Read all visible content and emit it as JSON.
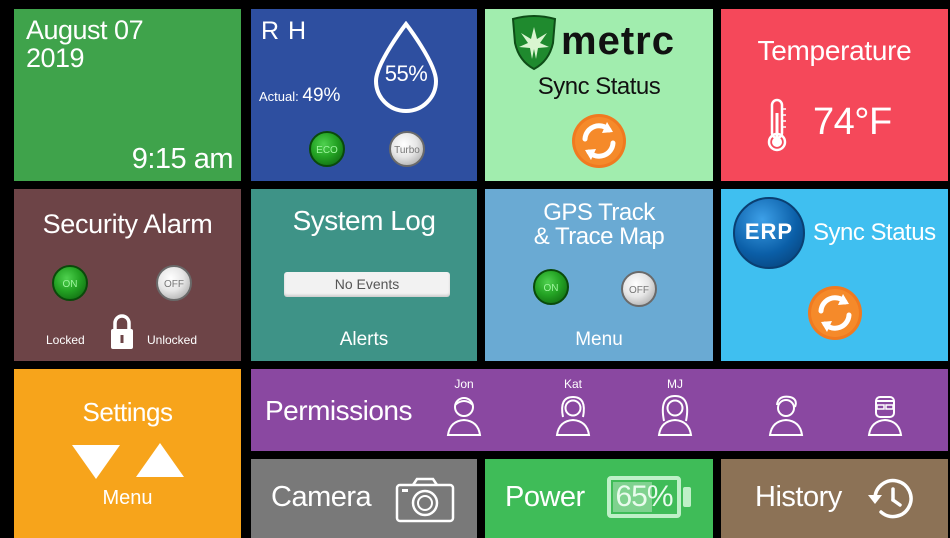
{
  "date_tile": {
    "line1": "August 07",
    "line2": "2019",
    "time": "9:15 am"
  },
  "rh_tile": {
    "title": "R H",
    "actual_label": "Actual:",
    "actual_value": "49%",
    "target_value": "55%",
    "eco_label": "ECO",
    "turbo_label": "Turbo"
  },
  "metrc_tile": {
    "brand": "metrc",
    "subtitle": "Sync Status"
  },
  "temperature_tile": {
    "title": "Temperature",
    "value": "74°F"
  },
  "security_tile": {
    "title": "Security Alarm",
    "on_label": "ON",
    "off_label": "OFF",
    "locked_label": "Locked",
    "unlocked_label": "Unlocked"
  },
  "log_tile": {
    "title": "System Log",
    "status": "No Events",
    "footer": "Alerts"
  },
  "gps_tile": {
    "title_line1": "GPS Track",
    "title_line2": "& Trace Map",
    "on_label": "ON",
    "off_label": "OFF",
    "footer": "Menu"
  },
  "erp_tile": {
    "logo": "ERP",
    "subtitle": "Sync Status"
  },
  "settings_tile": {
    "title": "Settings",
    "footer": "Menu"
  },
  "permissions_tile": {
    "title": "Permissions",
    "users": [
      {
        "name": "Jon"
      },
      {
        "name": "Kat"
      },
      {
        "name": "MJ"
      },
      {
        "name": ""
      },
      {
        "name": ""
      }
    ]
  },
  "camera_tile": {
    "title": "Camera"
  },
  "power_tile": {
    "title": "Power",
    "battery_level": "65%",
    "battery_fraction": 0.65
  },
  "history_tile": {
    "title": "History"
  },
  "colors": {
    "green": "#3fa34b",
    "blue": "#2e4fa0",
    "mint": "#a1edae",
    "red": "#f5485a",
    "maroon": "#6d4447",
    "teal": "#3e9387",
    "sky": "#6aaad3",
    "cyan": "#3fbff0",
    "orange": "#f7a41b",
    "purple": "#8a48a1",
    "gray": "#797979",
    "power_green": "#3fbc58",
    "brown": "#8c7256"
  }
}
